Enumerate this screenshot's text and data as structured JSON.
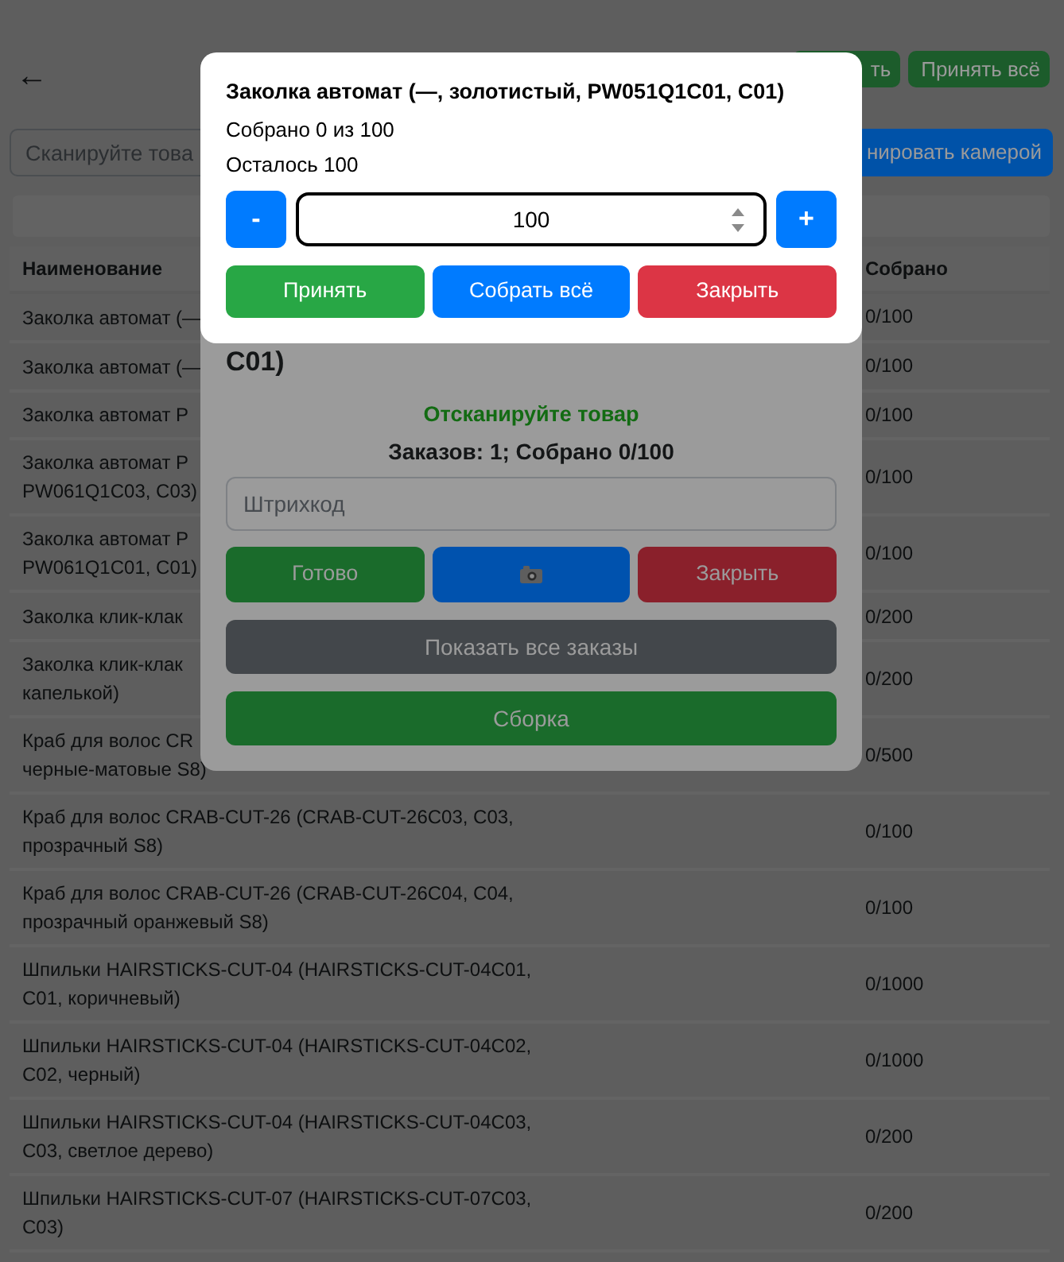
{
  "page": {
    "back": "←",
    "header_buttons": [
      {
        "label": "ть",
        "color": "#1c5c2b"
      },
      {
        "label": "Принять всё",
        "color": "#1c5c2b"
      }
    ],
    "search": {
      "placeholder": "Сканируйте това"
    },
    "scan_button": {
      "label": "нировать камерой",
      "color": "#0052a8"
    },
    "table": {
      "columns": [
        "Наименование",
        "Собрано"
      ],
      "rows": [
        {
          "name_lines": [
            "Заколка автомат (—"
          ],
          "collected": "0/100"
        },
        {
          "name_lines": [
            "Заколка автомат (—"
          ],
          "collected": "0/100"
        },
        {
          "name_lines": [
            "Заколка автомат P"
          ],
          "collected": "0/100"
        },
        {
          "name_lines": [
            "Заколка автомат P",
            "PW061Q1C03, C03)"
          ],
          "collected": "0/100"
        },
        {
          "name_lines": [
            "Заколка автомат P",
            "PW061Q1C01, C01)"
          ],
          "collected": "0/100"
        },
        {
          "name_lines": [
            "Заколка клик-клак"
          ],
          "collected": "0/200"
        },
        {
          "name_lines": [
            "Заколка клик-клак",
            "капелькой)"
          ],
          "collected": "0/200"
        },
        {
          "name_lines": [
            "Краб для волос CR",
            "черные-матовые S8)"
          ],
          "collected": "0/500"
        },
        {
          "name_lines": [
            "Краб для волос CRAB-CUT-26 (CRAB-CUT-26C03, C03, прозрачный S8)"
          ],
          "collected": "0/100"
        },
        {
          "name_lines": [
            "Краб для волос CRAB-CUT-26 (CRAB-CUT-26C04, C04, прозрачный оранжевый S8)"
          ],
          "collected": "0/100"
        },
        {
          "name_lines": [
            "Шпильки HAIRSTICKS-CUT-04 (HAIRSTICKS-CUT-04C01, C01, коричневый)"
          ],
          "collected": "0/1000"
        },
        {
          "name_lines": [
            "Шпильки HAIRSTICKS-CUT-04 (HAIRSTICKS-CUT-04C02, C02, черный)"
          ],
          "collected": "0/1000"
        },
        {
          "name_lines": [
            "Шпильки HAIRSTICKS-CUT-04 (HAIRSTICKS-CUT-04C03, C03, светлое дерево)"
          ],
          "collected": "0/200"
        },
        {
          "name_lines": [
            "Шпильки HAIRSTICKS-CUT-07 (HAIRSTICKS-CUT-07C03, C03)"
          ],
          "collected": "0/200"
        }
      ]
    }
  },
  "order_dialog": {
    "title_visible": "C01)",
    "status": "Отсканируйте товар",
    "summary": "Заказов: 1; Собрано 0/100",
    "barcode": {
      "placeholder": "Штрихкод"
    },
    "buttons": [
      {
        "kind": "text",
        "label": "Готово",
        "color": "#1a6b2b"
      },
      {
        "kind": "icon",
        "color": "#0052ae"
      },
      {
        "kind": "text",
        "label": "Закрыть",
        "color": "#8a202b"
      }
    ],
    "show_orders_button": {
      "label": "Показать все заказы",
      "color": "#43474b"
    },
    "assemble_button": {
      "label": "Сборка",
      "color": "#1a6b2b"
    }
  },
  "quantity_dialog": {
    "title": "Заколка автомат (—, золотистый, PW051Q1C01, C01)",
    "collected": "Собрано 0 из 100",
    "remaining": "Осталось 100",
    "decrement": "-",
    "quantity": {
      "value": "100"
    },
    "increment": "+",
    "buttons": [
      {
        "label": "Принять",
        "color": "#28a745"
      },
      {
        "label": "Собрать всё",
        "color": "#007bff"
      },
      {
        "label": "Закрыть",
        "color": "#dc3545"
      }
    ]
  }
}
